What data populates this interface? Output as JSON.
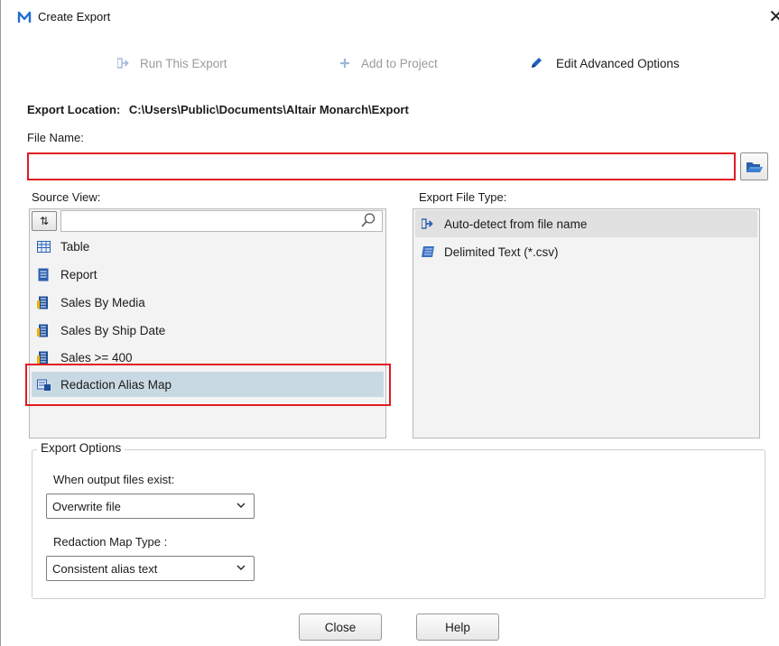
{
  "window": {
    "title": "Create Export",
    "logo_letter": "M",
    "close_glyph": "✕",
    "accent_color": "#1f6fd1"
  },
  "toolbar": {
    "run_label": "Run This Export",
    "add_label": "Add to Project",
    "edit_label": "Edit Advanced Options"
  },
  "export_location": {
    "label": "Export Location:",
    "path": "C:\\Users\\Public\\Documents\\Altair Monarch\\Export"
  },
  "file_name": {
    "label": "File Name:",
    "value": "",
    "placeholder": "",
    "invalid_border_color": "#e11b22"
  },
  "source_view": {
    "label": "Source View:",
    "sort_glyph": "⇅",
    "search_value": "",
    "items": [
      {
        "label": "Table",
        "icon": "table-icon"
      },
      {
        "label": "Report",
        "icon": "report-icon"
      },
      {
        "label": "Sales By Media",
        "icon": "summary-icon"
      },
      {
        "label": "Sales By Ship Date",
        "icon": "summary-icon"
      },
      {
        "label": "Sales >= 400",
        "icon": "summary-icon"
      },
      {
        "label": "Redaction Alias Map",
        "icon": "alias-map-icon",
        "selected": true
      }
    ],
    "selected_color": "#c8d9e3"
  },
  "export_file_type": {
    "label": "Export File Type:",
    "items": [
      {
        "label": "Auto-detect from file name",
        "icon": "auto-detect-icon",
        "selected": true
      },
      {
        "label": "Delimited Text (*.csv)",
        "icon": "csv-icon"
      }
    ]
  },
  "export_options": {
    "title": "Export Options",
    "when_exists_label": "When output files exist:",
    "when_exists_value": "Overwrite file",
    "map_type_label": "Redaction Map Type :",
    "map_type_value": "Consistent alias text"
  },
  "footer": {
    "close_label": "Close",
    "help_label": "Help"
  }
}
